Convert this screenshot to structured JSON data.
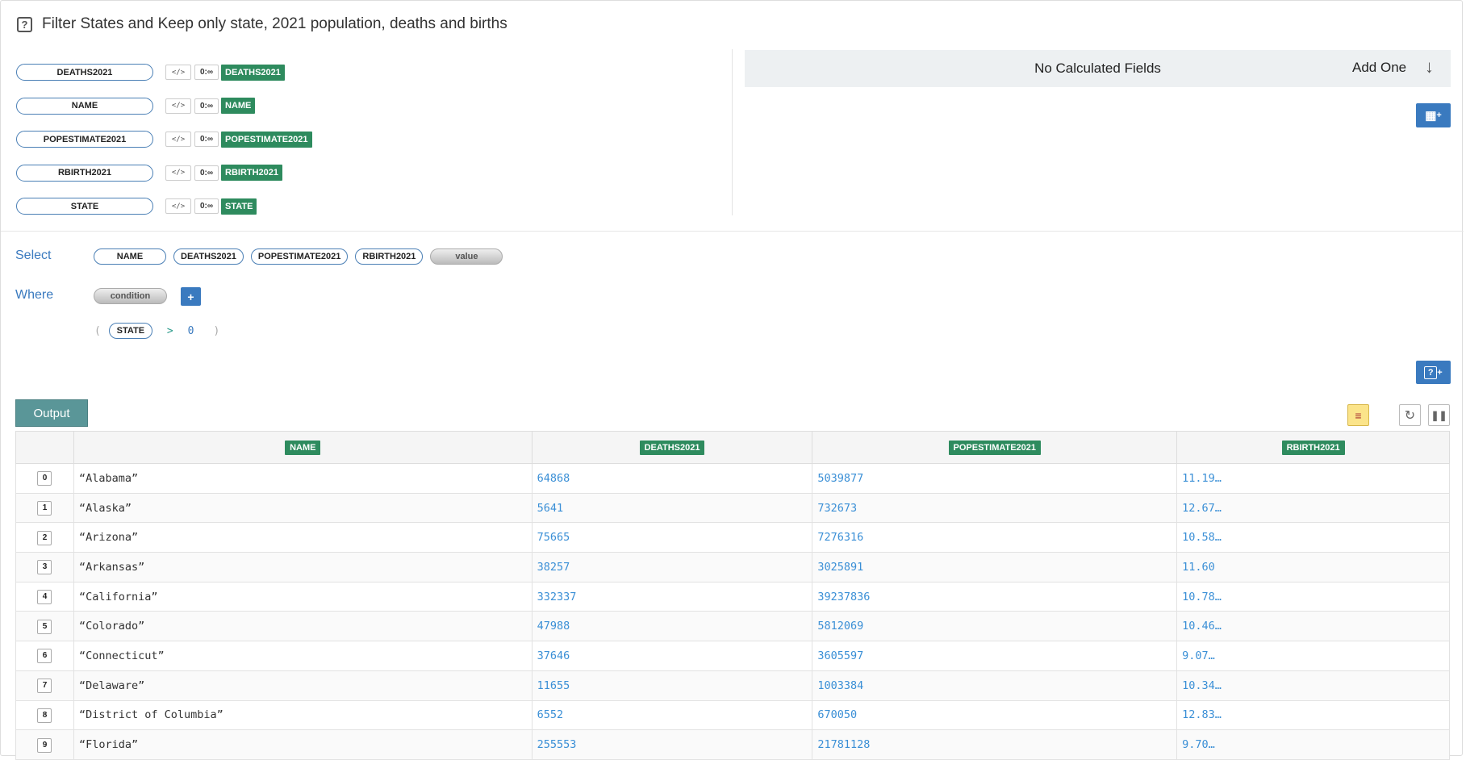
{
  "title": "Filter States and Keep only state, 2021 population, deaths and births",
  "fields": [
    {
      "name": "DEATHS2021",
      "code": "</>",
      "range": "0:∞",
      "tag": "DEATHS2021"
    },
    {
      "name": "NAME",
      "code": "</>",
      "range": "0:∞",
      "tag": "NAME"
    },
    {
      "name": "POPESTIMATE2021",
      "code": "</>",
      "range": "0:∞",
      "tag": "POPESTIMATE2021"
    },
    {
      "name": "RBIRTH2021",
      "code": "</>",
      "range": "0:∞",
      "tag": "RBIRTH2021"
    },
    {
      "name": "STATE",
      "code": "</>",
      "range": "0:∞",
      "tag": "STATE"
    }
  ],
  "calc": {
    "empty_text": "No Calculated Fields",
    "add_label": "Add One"
  },
  "select": {
    "label": "Select",
    "pills": [
      "NAME",
      "DEATHS2021",
      "POPESTIMATE2021",
      "RBIRTH2021"
    ],
    "value_pill": "value"
  },
  "where": {
    "label": "Where",
    "condition_pill": "condition",
    "add": "+",
    "expr": {
      "open": "(",
      "field": "STATE",
      "op": ">",
      "value": "0",
      "close": ")"
    }
  },
  "output": {
    "button": "Output",
    "columns": [
      "NAME",
      "DEATHS2021",
      "POPESTIMATE2021",
      "RBIRTH2021"
    ],
    "rows": [
      {
        "i": "0",
        "name": "“Alabama”",
        "deaths": "64868",
        "pop": "5039877",
        "rbirth": "11.19…"
      },
      {
        "i": "1",
        "name": "“Alaska”",
        "deaths": "5641",
        "pop": "732673",
        "rbirth": "12.67…"
      },
      {
        "i": "2",
        "name": "“Arizona”",
        "deaths": "75665",
        "pop": "7276316",
        "rbirth": "10.58…"
      },
      {
        "i": "3",
        "name": "“Arkansas”",
        "deaths": "38257",
        "pop": "3025891",
        "rbirth": "11.60"
      },
      {
        "i": "4",
        "name": "“California”",
        "deaths": "332337",
        "pop": "39237836",
        "rbirth": "10.78…"
      },
      {
        "i": "5",
        "name": "“Colorado”",
        "deaths": "47988",
        "pop": "5812069",
        "rbirth": "10.46…"
      },
      {
        "i": "6",
        "name": "“Connecticut”",
        "deaths": "37646",
        "pop": "3605597",
        "rbirth": "9.07…"
      },
      {
        "i": "7",
        "name": "“Delaware”",
        "deaths": "11655",
        "pop": "1003384",
        "rbirth": "10.34…"
      },
      {
        "i": "8",
        "name": "“District of Columbia”",
        "deaths": "6552",
        "pop": "670050",
        "rbirth": "12.83…"
      },
      {
        "i": "9",
        "name": "“Florida”",
        "deaths": "255553",
        "pop": "21781128",
        "rbirth": "9.70…"
      }
    ]
  },
  "colors": {
    "accent": "#3a7abf",
    "tag_green": "#2e8b5e",
    "output_btn": "#5a9698",
    "number_blue": "#3a8fd6"
  },
  "icons": [
    "help-icon",
    "down-arrow-icon",
    "calculator-add-icon",
    "help-add-icon",
    "broom-icon",
    "refresh-icon",
    "pause-icon"
  ]
}
